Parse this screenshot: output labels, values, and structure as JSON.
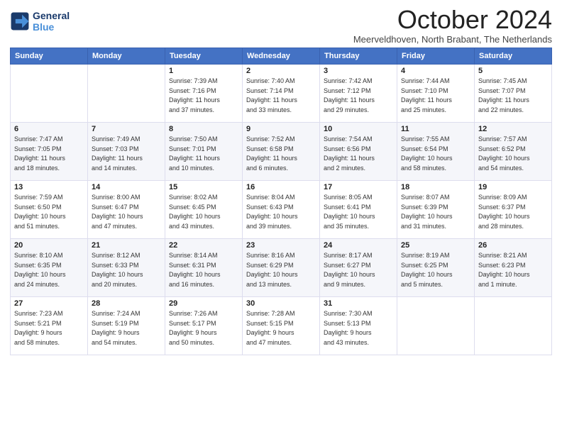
{
  "logo": {
    "line1": "General",
    "line2": "Blue"
  },
  "title": "October 2024",
  "location": "Meerveldhoven, North Brabant, The Netherlands",
  "days_header": [
    "Sunday",
    "Monday",
    "Tuesday",
    "Wednesday",
    "Thursday",
    "Friday",
    "Saturday"
  ],
  "weeks": [
    [
      {
        "day": "",
        "info": ""
      },
      {
        "day": "",
        "info": ""
      },
      {
        "day": "1",
        "info": "Sunrise: 7:39 AM\nSunset: 7:16 PM\nDaylight: 11 hours\nand 37 minutes."
      },
      {
        "day": "2",
        "info": "Sunrise: 7:40 AM\nSunset: 7:14 PM\nDaylight: 11 hours\nand 33 minutes."
      },
      {
        "day": "3",
        "info": "Sunrise: 7:42 AM\nSunset: 7:12 PM\nDaylight: 11 hours\nand 29 minutes."
      },
      {
        "day": "4",
        "info": "Sunrise: 7:44 AM\nSunset: 7:10 PM\nDaylight: 11 hours\nand 25 minutes."
      },
      {
        "day": "5",
        "info": "Sunrise: 7:45 AM\nSunset: 7:07 PM\nDaylight: 11 hours\nand 22 minutes."
      }
    ],
    [
      {
        "day": "6",
        "info": "Sunrise: 7:47 AM\nSunset: 7:05 PM\nDaylight: 11 hours\nand 18 minutes."
      },
      {
        "day": "7",
        "info": "Sunrise: 7:49 AM\nSunset: 7:03 PM\nDaylight: 11 hours\nand 14 minutes."
      },
      {
        "day": "8",
        "info": "Sunrise: 7:50 AM\nSunset: 7:01 PM\nDaylight: 11 hours\nand 10 minutes."
      },
      {
        "day": "9",
        "info": "Sunrise: 7:52 AM\nSunset: 6:58 PM\nDaylight: 11 hours\nand 6 minutes."
      },
      {
        "day": "10",
        "info": "Sunrise: 7:54 AM\nSunset: 6:56 PM\nDaylight: 11 hours\nand 2 minutes."
      },
      {
        "day": "11",
        "info": "Sunrise: 7:55 AM\nSunset: 6:54 PM\nDaylight: 10 hours\nand 58 minutes."
      },
      {
        "day": "12",
        "info": "Sunrise: 7:57 AM\nSunset: 6:52 PM\nDaylight: 10 hours\nand 54 minutes."
      }
    ],
    [
      {
        "day": "13",
        "info": "Sunrise: 7:59 AM\nSunset: 6:50 PM\nDaylight: 10 hours\nand 51 minutes."
      },
      {
        "day": "14",
        "info": "Sunrise: 8:00 AM\nSunset: 6:47 PM\nDaylight: 10 hours\nand 47 minutes."
      },
      {
        "day": "15",
        "info": "Sunrise: 8:02 AM\nSunset: 6:45 PM\nDaylight: 10 hours\nand 43 minutes."
      },
      {
        "day": "16",
        "info": "Sunrise: 8:04 AM\nSunset: 6:43 PM\nDaylight: 10 hours\nand 39 minutes."
      },
      {
        "day": "17",
        "info": "Sunrise: 8:05 AM\nSunset: 6:41 PM\nDaylight: 10 hours\nand 35 minutes."
      },
      {
        "day": "18",
        "info": "Sunrise: 8:07 AM\nSunset: 6:39 PM\nDaylight: 10 hours\nand 31 minutes."
      },
      {
        "day": "19",
        "info": "Sunrise: 8:09 AM\nSunset: 6:37 PM\nDaylight: 10 hours\nand 28 minutes."
      }
    ],
    [
      {
        "day": "20",
        "info": "Sunrise: 8:10 AM\nSunset: 6:35 PM\nDaylight: 10 hours\nand 24 minutes."
      },
      {
        "day": "21",
        "info": "Sunrise: 8:12 AM\nSunset: 6:33 PM\nDaylight: 10 hours\nand 20 minutes."
      },
      {
        "day": "22",
        "info": "Sunrise: 8:14 AM\nSunset: 6:31 PM\nDaylight: 10 hours\nand 16 minutes."
      },
      {
        "day": "23",
        "info": "Sunrise: 8:16 AM\nSunset: 6:29 PM\nDaylight: 10 hours\nand 13 minutes."
      },
      {
        "day": "24",
        "info": "Sunrise: 8:17 AM\nSunset: 6:27 PM\nDaylight: 10 hours\nand 9 minutes."
      },
      {
        "day": "25",
        "info": "Sunrise: 8:19 AM\nSunset: 6:25 PM\nDaylight: 10 hours\nand 5 minutes."
      },
      {
        "day": "26",
        "info": "Sunrise: 8:21 AM\nSunset: 6:23 PM\nDaylight: 10 hours\nand 1 minute."
      }
    ],
    [
      {
        "day": "27",
        "info": "Sunrise: 7:23 AM\nSunset: 5:21 PM\nDaylight: 9 hours\nand 58 minutes."
      },
      {
        "day": "28",
        "info": "Sunrise: 7:24 AM\nSunset: 5:19 PM\nDaylight: 9 hours\nand 54 minutes."
      },
      {
        "day": "29",
        "info": "Sunrise: 7:26 AM\nSunset: 5:17 PM\nDaylight: 9 hours\nand 50 minutes."
      },
      {
        "day": "30",
        "info": "Sunrise: 7:28 AM\nSunset: 5:15 PM\nDaylight: 9 hours\nand 47 minutes."
      },
      {
        "day": "31",
        "info": "Sunrise: 7:30 AM\nSunset: 5:13 PM\nDaylight: 9 hours\nand 43 minutes."
      },
      {
        "day": "",
        "info": ""
      },
      {
        "day": "",
        "info": ""
      }
    ]
  ]
}
